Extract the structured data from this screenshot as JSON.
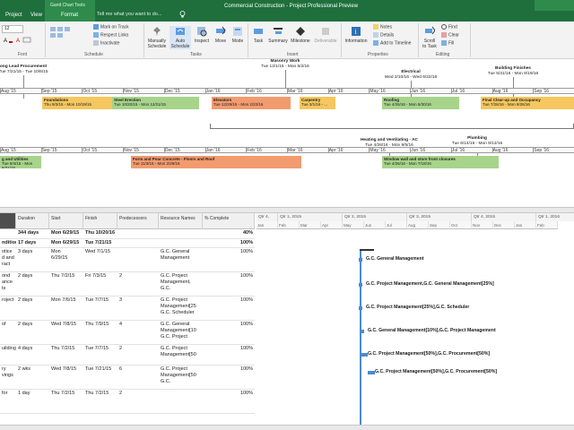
{
  "titlebar": {
    "tabs": [
      "Project",
      "View",
      "Format"
    ],
    "context_group": "Gantt Chart Tools",
    "tell_me": "Tell me what you want to do...",
    "document_title": "Commercial Construction - Project Professional Preview"
  },
  "ribbon": {
    "font_size": "12",
    "font_label": "Font",
    "groups": [
      "Schedule",
      "Tasks",
      "Insert",
      "Properties",
      "Editing"
    ],
    "schedule_items": [
      "Mark on Track",
      "Respect Links",
      "Inactivate"
    ],
    "buttons": [
      {
        "label": "Manually\nSchedule"
      },
      {
        "label": "Auto\nSchedule"
      },
      {
        "label": "Inspect"
      },
      {
        "label": "Move"
      },
      {
        "label": "Mode"
      },
      {
        "label": "Task"
      },
      {
        "label": "Summary"
      },
      {
        "label": "Milestone"
      },
      {
        "label": "Deliverable"
      },
      {
        "label": "Information"
      },
      {
        "label": "Scroll\nto Task"
      }
    ],
    "properties_items": [
      "Notes",
      "Details",
      "Add to Timeline"
    ],
    "editing_items": [
      "Find",
      "Clear",
      "Fill"
    ]
  },
  "timeline": {
    "top_scale": [
      "Aug '15",
      "Sep '15",
      "Oct '15",
      "Nov '15",
      "Dec '15",
      "Jan '16",
      "Feb '16",
      "Mar '16",
      "Apr '16",
      "May '16",
      "Jun '16",
      "Jul '16",
      "Aug '16",
      "Sep '16"
    ],
    "bottom_scale": [
      "Aug '15",
      "Sep '15",
      "Oct '15",
      "Nov '15",
      "Dec '15",
      "Jan '16",
      "Feb '16",
      "Mar '16",
      "Apr '16",
      "May '16",
      "Jun '16",
      "Jul '16",
      "Aug '16",
      "Sep '16"
    ],
    "callouts": [
      {
        "title": "ong Lead Procurement",
        "dates": "Tue 7/21/15 - Tue 10/6/15"
      },
      {
        "title": "Masonry Work",
        "dates": "Tue 12/1/15 - Mon 5/2/16"
      },
      {
        "title": "Electrical",
        "dates": "Wed 2/10/16 - Wed 6/22/16"
      },
      {
        "title": "Building Finishes",
        "dates": "Tue 5/31/16 - Mon 9/19/16"
      },
      {
        "title": "Heating and Ventilating - AC",
        "dates": "Tue 4/26/16 - Mon 9/5/16"
      },
      {
        "title": "Plumbing",
        "dates": "Tue 6/14/16 - Mon 9/12/16"
      }
    ],
    "bars_row1": [
      {
        "name": "Foundations",
        "dates": "Thu 9/3/15 - Mon 10/19/15",
        "color": "#f5c75e"
      },
      {
        "name": "Steel Erection",
        "dates": "Tue 10/20/15 - Mon 12/21/15",
        "color": "#a7d48a"
      },
      {
        "name": "Elevators",
        "dates": "Tue 12/29/15 - Mon 2/22/16",
        "color": "#f29b6e"
      },
      {
        "name": "Carpentry",
        "dates": "Tue 3/1/16 - ...",
        "color": "#f5c75e"
      },
      {
        "name": "Roofing",
        "dates": "Tue 4/26/16 - Mon 5/30/16",
        "color": "#a7d48a"
      },
      {
        "name": "Final Clear-up and Occupancy",
        "dates": "Tue 7/26/16 - Mon 9/26/16",
        "color": "#f5c75e"
      }
    ],
    "bars_row2": [
      {
        "name": "g and Utilities",
        "dates": "Tue 8/4/15 - Mon 8/31/15",
        "color": "#a7d48a"
      },
      {
        "name": "Form and Pour Concrete - Floors and Roof",
        "dates": "Tue 11/3/15 - Mon 2/29/16",
        "color": "#f29b6e"
      },
      {
        "name": "Window wall and store front closures",
        "dates": "Tue 4/26/16 - Mon 7/18/16",
        "color": "#a7d48a"
      }
    ]
  },
  "grid": {
    "headers": [
      "Duration",
      "Start",
      "Finish",
      "Predecessors",
      "Resource Names",
      "% Complete"
    ],
    "rows": [
      {
        "name": "",
        "duration": "344 days",
        "start": "Mon 6/29/15",
        "finish": "Thu 10/20/16",
        "pred": "",
        "res": "",
        "pct": "40%",
        "bold": true
      },
      {
        "name": "nditior",
        "duration": "17 days",
        "start": "Mon 6/29/15",
        "finish": "Tue 7/21/15",
        "pred": "",
        "res": "",
        "pct": "100%",
        "bold": true
      },
      {
        "name": "otice\nd and\nract",
        "duration": "3 days",
        "start": "Mon\n6/29/15",
        "finish": "Wed 7/1/15",
        "pred": "",
        "res": "G.C. General\nManagement",
        "pct": "100%",
        "bold": false
      },
      {
        "name": "ond\nance\nts",
        "duration": "2 days",
        "start": "Thu 7/2/15",
        "finish": "Fri 7/3/15",
        "pred": "2",
        "res": "G.C. Project\nManagement,\nG.C.",
        "pct": "100%",
        "bold": false
      },
      {
        "name": "roject",
        "duration": "2 days",
        "start": "Mon 7/6/15",
        "finish": "Tue 7/7/15",
        "pred": "3",
        "res": "G.C. Project\nManagement[25\nG.C. Scheduler",
        "pct": "100%",
        "bold": false
      },
      {
        "name": "of",
        "duration": "2 days",
        "start": "Wed 7/8/15",
        "finish": "Thu 7/9/15",
        "pred": "4",
        "res": "G.C. General\nManagement[10\nG.C. Project",
        "pct": "100%",
        "bold": false
      },
      {
        "name": "uilding",
        "duration": "4 days",
        "start": "Thu 7/2/15",
        "finish": "Tue 7/7/15",
        "pred": "2",
        "res": "G.C. Project\nManagement[50",
        "pct": "100%",
        "bold": false
      },
      {
        "name": "ry\nvings",
        "duration": "2 wks",
        "start": "Wed 7/8/15",
        "finish": "Tue 7/21/15",
        "pred": "6",
        "res": "G.C. Project\nManagement[50\nG.C.",
        "pct": "100%",
        "bold": false
      },
      {
        "name": "for",
        "duration": "1 day",
        "start": "Thu 7/2/15",
        "finish": "Thu 7/2/15",
        "pred": "2",
        "res": "",
        "pct": "100%",
        "bold": false
      }
    ]
  },
  "chart": {
    "quarters": [
      "Qtr 1, 2015",
      "Qtr 2, 2015",
      "Qtr 3, 2015",
      "Qtr 4, 2015",
      "Qtr 1, 2016"
    ],
    "quarter_prefix": "Qtr 4, 2014",
    "months": [
      "Jan",
      "Feb",
      "Mar",
      "Apr",
      "May",
      "Jun",
      "Jul",
      "Aug",
      "Sep",
      "Oct",
      "Nov",
      "Dec",
      "Jan",
      "Feb"
    ],
    "labels": [
      "G.C. General Management",
      "G.C. Project Management,G.C. General Management[25%]",
      "G.C. Project Management[25%],G.C. Scheduler",
      "G.C. General Management[10%],G.C. Project Management",
      "G.C. Project Management[50%],G.C. Procurement[50%]",
      "G.C. Project Management[50%],G.C. Procurement[50%]"
    ]
  }
}
